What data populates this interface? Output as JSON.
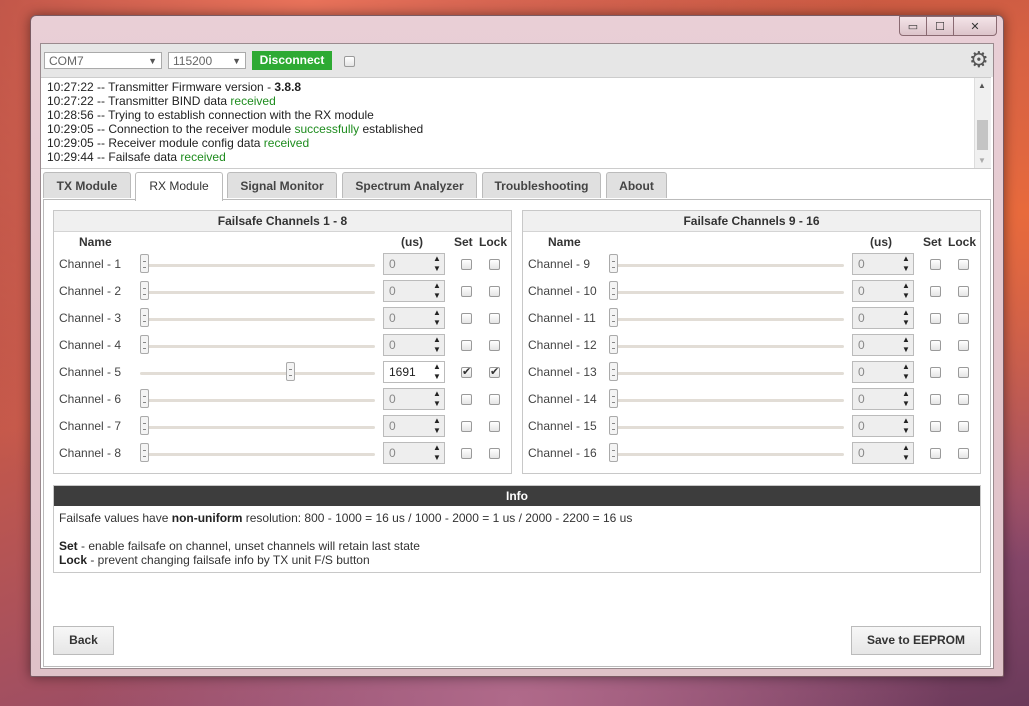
{
  "window": {
    "controls": [
      "▭",
      "☐",
      "✕"
    ]
  },
  "connection": {
    "port": "COM7",
    "baud": "115200",
    "disconnect_label": "Disconnect"
  },
  "log": [
    {
      "pre": "10:27:22 -- Transmitter Firmware version - ",
      "hl": "3.8.8",
      "post": "",
      "hl_style": "bold"
    },
    {
      "pre": "10:27:22 -- Transmitter BIND data ",
      "hl": "received",
      "post": "",
      "hl_style": "green"
    },
    {
      "pre": "10:28:56 -- Trying to establish connection with the RX module",
      "hl": "",
      "post": "",
      "hl_style": ""
    },
    {
      "pre": "10:29:05 -- Connection to the receiver module ",
      "hl": "successfully",
      "post": " established",
      "hl_style": "green"
    },
    {
      "pre": "10:29:05 -- Receiver module config data ",
      "hl": "received",
      "post": "",
      "hl_style": "green"
    },
    {
      "pre": "10:29:44 -- Failsafe data ",
      "hl": "received",
      "post": "",
      "hl_style": "green"
    }
  ],
  "tabs": [
    "TX Module",
    "RX Module",
    "Signal Monitor",
    "Spectrum Analyzer",
    "Troubleshooting",
    "About"
  ],
  "active_tab": 1,
  "panels": [
    {
      "title": "Failsafe Channels 1 - 8",
      "headers": {
        "name": "Name",
        "us": "(us)",
        "set": "Set",
        "lock": "Lock"
      },
      "channels": [
        {
          "label": "Channel - 1",
          "value": "0",
          "level": 0,
          "set": false,
          "lock": false
        },
        {
          "label": "Channel - 2",
          "value": "0",
          "level": 0,
          "set": false,
          "lock": false
        },
        {
          "label": "Channel - 3",
          "value": "0",
          "level": 0,
          "set": false,
          "lock": false
        },
        {
          "label": "Channel - 4",
          "value": "0",
          "level": 0,
          "set": false,
          "lock": false
        },
        {
          "label": "Channel - 5",
          "value": "1691",
          "level": 0.62,
          "set": true,
          "lock": true
        },
        {
          "label": "Channel - 6",
          "value": "0",
          "level": 0,
          "set": false,
          "lock": false
        },
        {
          "label": "Channel - 7",
          "value": "0",
          "level": 0,
          "set": false,
          "lock": false
        },
        {
          "label": "Channel - 8",
          "value": "0",
          "level": 0,
          "set": false,
          "lock": false
        }
      ]
    },
    {
      "title": "Failsafe Channels 9 - 16",
      "headers": {
        "name": "Name",
        "us": "(us)",
        "set": "Set",
        "lock": "Lock"
      },
      "channels": [
        {
          "label": "Channel - 9",
          "value": "0",
          "level": 0,
          "set": false,
          "lock": false
        },
        {
          "label": "Channel - 10",
          "value": "0",
          "level": 0,
          "set": false,
          "lock": false
        },
        {
          "label": "Channel - 11",
          "value": "0",
          "level": 0,
          "set": false,
          "lock": false
        },
        {
          "label": "Channel - 12",
          "value": "0",
          "level": 0,
          "set": false,
          "lock": false
        },
        {
          "label": "Channel - 13",
          "value": "0",
          "level": 0,
          "set": false,
          "lock": false
        },
        {
          "label": "Channel - 14",
          "value": "0",
          "level": 0,
          "set": false,
          "lock": false
        },
        {
          "label": "Channel - 15",
          "value": "0",
          "level": 0,
          "set": false,
          "lock": false
        },
        {
          "label": "Channel - 16",
          "value": "0",
          "level": 0,
          "set": false,
          "lock": false
        }
      ]
    }
  ],
  "info": {
    "title": "Info",
    "line1_pre": "Failsafe values have ",
    "line1_bold": "non-uniform",
    "line1_post": " resolution: 800 - 1000 = 16 us / 1000 - 2000 = 1 us / 2000 - 2200 = 16 us",
    "set_term": "Set",
    "set_desc": " - enable failsafe on channel, unset channels will retain last state",
    "lock_term": "Lock",
    "lock_desc": " - prevent changing failsafe info by TX unit F/S button"
  },
  "buttons": {
    "back": "Back",
    "save": "Save to EEPROM"
  },
  "colors": {
    "connected_green": "#2eaa33",
    "log_highlight": "#1e8c1e",
    "info_header": "#3d3d3d"
  },
  "icons": {
    "settings": "gear-icon"
  }
}
